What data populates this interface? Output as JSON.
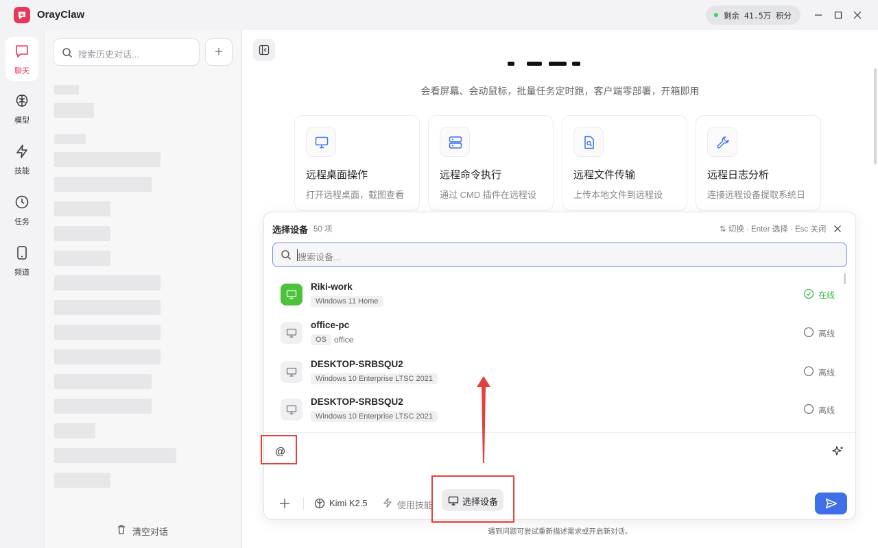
{
  "app": {
    "title": "OrayClaw"
  },
  "credits": {
    "text": "剩余 41.5万 积分"
  },
  "rail": [
    {
      "label": "聊天",
      "icon": "chat-icon"
    },
    {
      "label": "模型",
      "icon": "brain-icon"
    },
    {
      "label": "技能",
      "icon": "lightning-icon"
    },
    {
      "label": "任务",
      "icon": "clock-icon"
    },
    {
      "label": "频道",
      "icon": "phone-icon"
    }
  ],
  "history": {
    "search_placeholder": "搜索历史对话...",
    "clear_label": "清空对话"
  },
  "main": {
    "subtitle": "会看屏幕、会动鼠标，批量任务定时跑，客户端零部署，开箱即用",
    "cards": [
      {
        "title": "远程桌面操作",
        "desc": "打开远程桌面，截图查看",
        "icon": "monitor-icon"
      },
      {
        "title": "远程命令执行",
        "desc": "通过 CMD 插件在远程设",
        "icon": "server-icon"
      },
      {
        "title": "远程文件传输",
        "desc": "上传本地文件到远程设",
        "icon": "file-search-icon"
      },
      {
        "title": "远程日志分析",
        "desc": "连接远程设备提取系统日",
        "icon": "wrench-icon"
      }
    ]
  },
  "device_picker": {
    "title": "选择设备",
    "count": "50 项",
    "hint": "⇅ 切换 · Enter 选择 · Esc 关闭",
    "search_placeholder": "搜索设备...",
    "devices": [
      {
        "name": "Riki-work",
        "os": "Windows 11 Home",
        "status": "在线",
        "online": true
      },
      {
        "name": "office-pc",
        "os": "OS",
        "os_extra": "office",
        "status": "离线",
        "online": false
      },
      {
        "name": "DESKTOP-SRBSQU2",
        "os": "Windows 10 Enterprise LTSC 2021",
        "status": "离线",
        "online": false
      },
      {
        "name": "DESKTOP-SRBSQU2",
        "os": "Windows 10 Enterprise LTSC 2021",
        "status": "离线",
        "online": false
      }
    ]
  },
  "composer": {
    "input_value": "@",
    "model_label": "Kimi K2.5",
    "skill_label": "使用技能",
    "device_label": "选择设备"
  },
  "footnote": "遇到问题可尝试重新描述需求或开启新对话。",
  "colors": {
    "brand": "#e8375a",
    "accent": "#3f6fe8",
    "online": "#4cc23a",
    "annotation": "#e2413d"
  }
}
